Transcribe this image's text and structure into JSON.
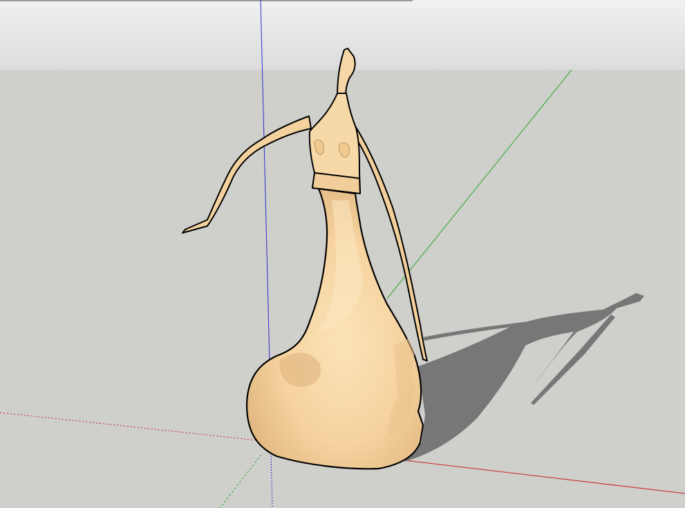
{
  "viewport": {
    "colors": {
      "sky_top": "#f1f1f1",
      "sky_bottom": "#d9d9d9",
      "ground": "#cfcfcc",
      "shadow": "#7a7a7a",
      "model_face": "#f6d9a6",
      "model_highlight": "#fbe7c2",
      "model_shade": "#d9b27e",
      "edge": "#000000",
      "axis_red": "#cc2222",
      "axis_green": "#22aa22",
      "axis_blue": "#2222cc"
    },
    "axes": {
      "red_icon": "red-axis-line",
      "green_icon": "green-axis-line",
      "blue_icon": "blue-axis-line"
    },
    "model": {
      "icon": "figurine-sculpture-model"
    }
  }
}
